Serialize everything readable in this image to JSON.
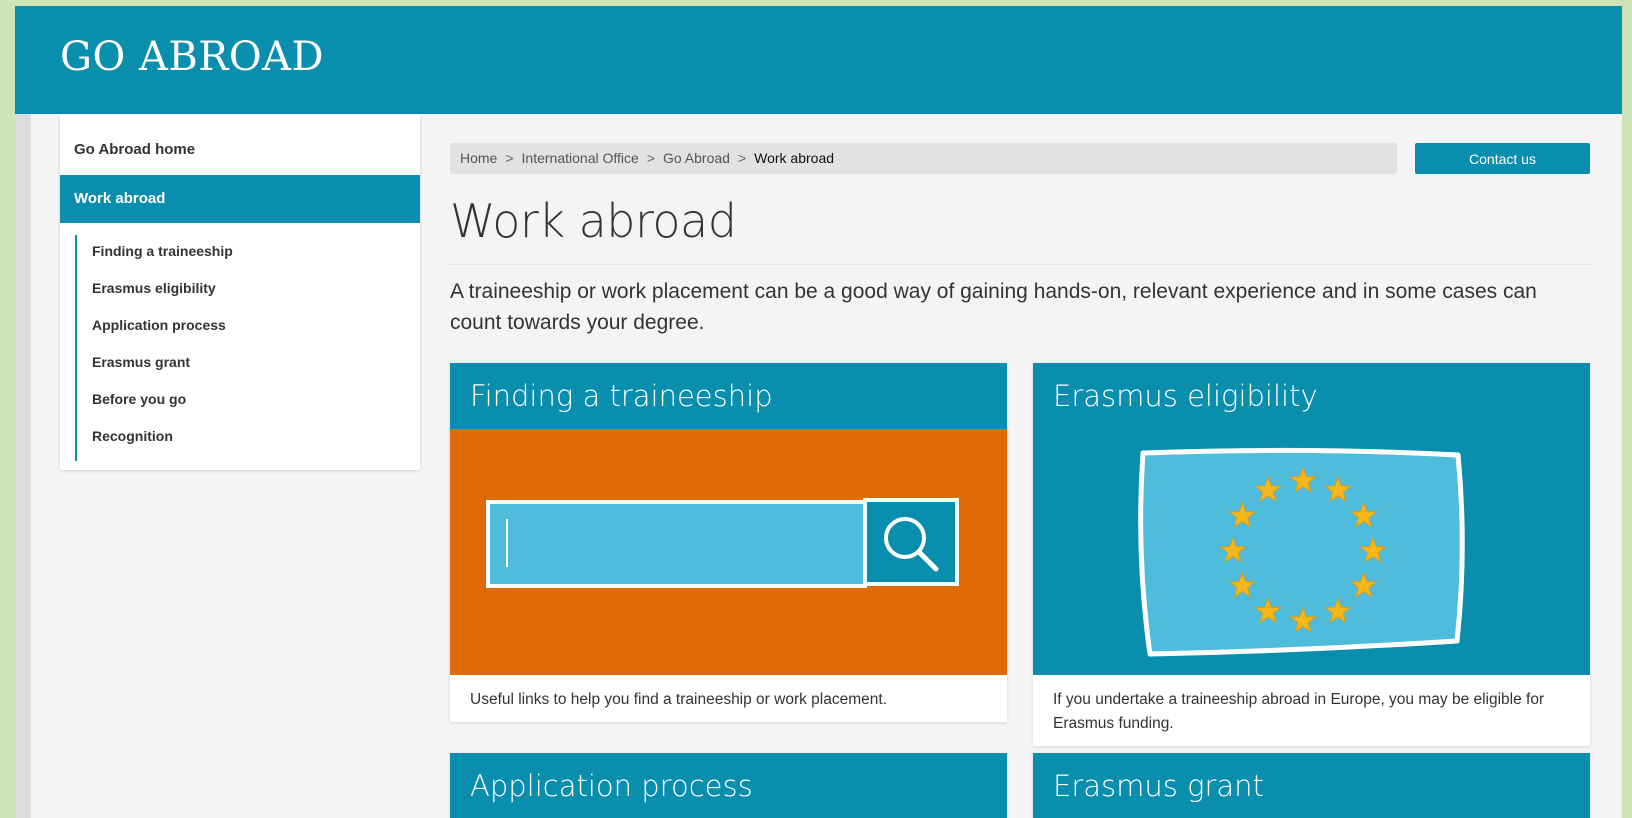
{
  "header": {
    "site_title": "GO ABROAD"
  },
  "sidebar": {
    "home": "Go Abroad home",
    "active": "Work abroad",
    "items": [
      {
        "label": "Finding a traineeship"
      },
      {
        "label": "Erasmus eligibility"
      },
      {
        "label": "Application process"
      },
      {
        "label": "Erasmus grant"
      },
      {
        "label": "Before you go"
      },
      {
        "label": "Recognition"
      }
    ]
  },
  "breadcrumb": {
    "items": [
      "Home",
      "International Office",
      "Go Abroad"
    ],
    "current": "Work abroad",
    "separator": ">"
  },
  "contact_button": "Contact us",
  "page": {
    "title": "Work abroad",
    "intro": "A traineeship or work placement can be a good way of gaining hands-on, relevant experience and in some cases can count towards your degree."
  },
  "cards": [
    {
      "title": "Finding a traineeship",
      "text": "Useful links to help you find a traineeship or work placement.",
      "icon": "search-illustration"
    },
    {
      "title": "Erasmus eligibility",
      "text": "If you undertake a traineeship abroad in Europe, you may be eligible for Erasmus funding.",
      "icon": "eu-flag-illustration"
    },
    {
      "title": "Application process"
    },
    {
      "title": "Erasmus grant"
    }
  ],
  "colors": {
    "brand_teal": "#0a8ead",
    "orange": "#e06a07",
    "light_blue": "#4fbcdb",
    "star_gold": "#f5b81c",
    "page_bg": "#f4f4f4",
    "outer_bg": "#cde3b8"
  }
}
